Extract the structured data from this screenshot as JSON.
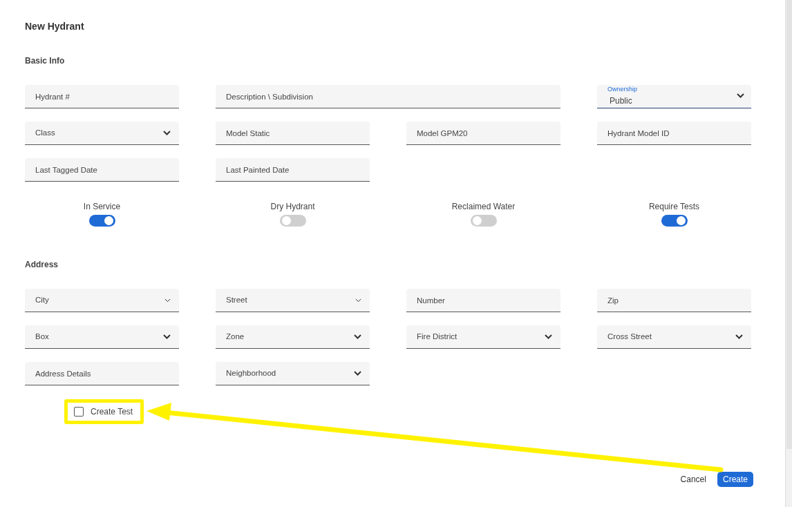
{
  "dialog": {
    "title": "New Hydrant"
  },
  "sections": [
    {
      "title": "Basic Info",
      "fields": [
        {
          "placeholder": "Hydrant #",
          "kind": "text"
        },
        {
          "placeholder": "Description \\ Subdivision",
          "kind": "wide-text"
        },
        {
          "label": "Ownership",
          "kind": "select",
          "value": "Public"
        },
        {
          "label": "Class",
          "kind": "select"
        },
        {
          "placeholder": "Model Static",
          "kind": "text"
        },
        {
          "placeholder": "Model GPM20",
          "kind": "text"
        },
        {
          "placeholder": "Hydrant Model ID",
          "kind": "text"
        },
        {
          "placeholder": "Last Tagged Date",
          "kind": "text"
        },
        {
          "placeholder": "Last Painted Date",
          "kind": "text"
        }
      ],
      "toggles": [
        {
          "label": "In Service",
          "on": true
        },
        {
          "label": "Dry Hydrant",
          "on": false
        },
        {
          "label": "Reclaimed Water",
          "on": false
        },
        {
          "label": "Require Tests",
          "on": true
        }
      ]
    },
    {
      "title": "Address",
      "fields": [
        {
          "label": "City",
          "kind": "combo"
        },
        {
          "label": "Street",
          "kind": "combo"
        },
        {
          "placeholder": "Number",
          "kind": "text"
        },
        {
          "placeholder": "Zip",
          "kind": "text"
        },
        {
          "label": "Box",
          "kind": "select"
        },
        {
          "label": "Zone",
          "kind": "select"
        },
        {
          "label": "Fire District",
          "kind": "select"
        },
        {
          "label": "Cross Street",
          "kind": "select"
        },
        {
          "placeholder": "Address Details",
          "kind": "text"
        },
        {
          "label": "Neighborhood",
          "kind": "select"
        }
      ]
    }
  ],
  "create_test": {
    "label": "Create Test",
    "checked": false
  },
  "buttons": {
    "cancel": "Cancel",
    "create": "Create"
  }
}
